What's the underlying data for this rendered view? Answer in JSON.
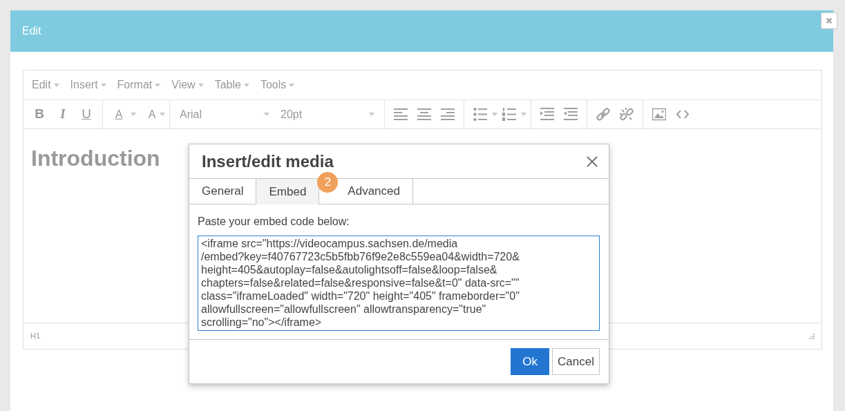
{
  "window": {
    "title": "Edit"
  },
  "editor": {
    "menus": [
      "Edit",
      "Insert",
      "Format",
      "View",
      "Table",
      "Tools"
    ],
    "format_buttons": [
      {
        "kind": "bold",
        "label": "B"
      },
      {
        "kind": "italic",
        "label": "I"
      },
      {
        "kind": "underline",
        "label": "U"
      },
      {
        "kind": "textcolor",
        "label": "A"
      },
      {
        "kind": "bgcolor",
        "label": "A"
      }
    ],
    "font_family": "Arial",
    "font_size": "20pt",
    "heading": "Introduction",
    "status": "H1"
  },
  "dialog": {
    "title": "Insert/edit media",
    "tabs": [
      {
        "label": "General",
        "selected": false
      },
      {
        "label": "Embed",
        "selected": true
      },
      {
        "label": "Advanced",
        "selected": false
      }
    ],
    "badge": "2",
    "prompt": "Paste your embed code below:",
    "embed_code_lines": [
      "<iframe src=\"https://videocampus.sachsen.de/media",
      "/embed?key=f40767723c5b5fbb76f9e2e8c559ea04&width=720&",
      "height=405&autoplay=false&autolightsoff=false&loop=false&",
      "chapters=false&related=false&responsive=false&t=0\" data-src=\"\"",
      "class=\"iframeLoaded\" width=\"720\" height=\"405\" frameborder=\"0\"",
      "allowfullscreen=\"allowfullscreen\" allowtransparency=\"true\"",
      "scrolling=\"no\"></iframe>"
    ],
    "buttons": [
      {
        "label": "Ok",
        "kind": "primary"
      },
      {
        "label": "Cancel",
        "kind": "secondary"
      }
    ]
  }
}
